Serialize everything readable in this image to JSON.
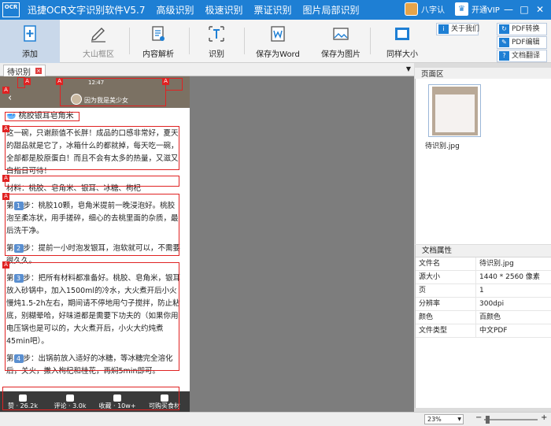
{
  "titlebar": {
    "logo": "OCR",
    "title": "迅捷OCR文字识别软件V5.7",
    "tabs": [
      "高级识别",
      "极速识别",
      "票证识别",
      "图片局部识别"
    ],
    "user": "八字认",
    "vip": "开通VIP",
    "controls": [
      "—",
      "□",
      "✕"
    ]
  },
  "toolbar": {
    "add": "添加",
    "area": "大山框区",
    "parse": "内容解析",
    "recognize": "识别",
    "save_word": "保存为Word",
    "save_image": "保存为图片",
    "same_size": "同样大小",
    "about": "关于我们",
    "pdf_convert": "PDF转换",
    "pdf_edit": "PDF编辑",
    "doc_translate": "文档翻译"
  },
  "tab": {
    "name": "待识别"
  },
  "phone": {
    "time": "12:47",
    "author": "因为我是美少女",
    "title": "桃胶银耳皂角米",
    "para1": "这一碗，只谢颜值不长胖！成品的口感非常好，夏天的甜品就是它了，冰箱什么的都就掉，每天吃一碗，全部都是胶原蛋白！而且不会有太多的热量，又滋又白指日可待！",
    "ingredients": "材料：桃胶、皂角米、银耳、冰糖、枸杞",
    "step_word": "第",
    "step_suffix": "步：",
    "step1_num": "1",
    "step1": "桃胶10颗，皂角米提前一晚浸泡好。桃胶泡至柔冻状，用手搓碎，细心的去桃里面的杂质，最后洗干净。",
    "step2_num": "2",
    "step2": "提前一小时泡发银耳，泡软就可以，不需要很久久。",
    "step3_num": "3",
    "step3": "把所有材料都准备好。桃胶、皂角米，银耳放入砂锅中，加入1500ml的冷水，大火煮开后小火慢炖1.5-2h左右，期间请不停地用勺子搅拌，防止粘底，别糊晕哈，好味道都是需要下功夫的（如果你用电压锅也是可以的，大火煮开后，小火大约炖煮45min吧）。",
    "step4_num": "4",
    "step4": "出锅前放入适好的冰糖，等冰糖完全溶化后，关火，撒入枸杞和桂花，再焖5min即可。",
    "footer": [
      "赞 · 26.2k",
      "评论 · 3.0k",
      "收藏 · 10w+",
      "可购买食材"
    ]
  },
  "page_panel": {
    "title": "页面区",
    "thumb_caption": "待识别.jpg"
  },
  "props": {
    "title": "文档属性",
    "rows": [
      {
        "k": "文件名",
        "v": "待识别.jpg"
      },
      {
        "k": "源大小",
        "v": "1440 * 2560 像素"
      },
      {
        "k": "页",
        "v": "1"
      },
      {
        "k": "分辨率",
        "v": "300dpi"
      },
      {
        "k": "颜色",
        "v": "百颜色"
      },
      {
        "k": "文件类型",
        "v": "中文PDF"
      }
    ]
  },
  "status": {
    "zoom": "23%",
    "minus": "−",
    "plus": "+"
  },
  "colors": {
    "brand": "#1e7fd4",
    "mark": "#e02222"
  }
}
